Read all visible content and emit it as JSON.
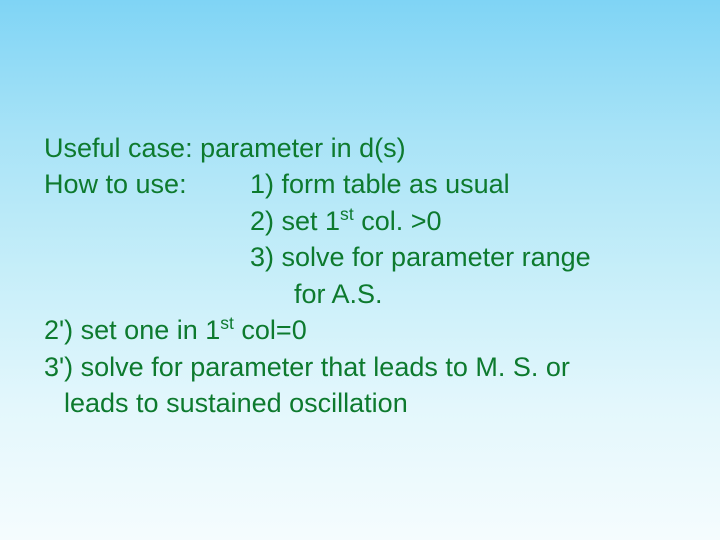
{
  "line1": "Useful case: parameter in d(s)",
  "howto_label": "How to use:",
  "step1": "1) form table as usual",
  "step2_a": "2) set 1",
  "step2_sup": "st",
  "step2_b": " col. >0",
  "step3_a": "3) solve for parameter range",
  "step3_b": "for A.S.",
  "step2p_a": "2') set one in 1",
  "step2p_sup": "st",
  "step2p_b": " col=0",
  "step3p_a": "3') solve for parameter that leads to M. S. or",
  "step3p_b": "leads to sustained oscillation"
}
